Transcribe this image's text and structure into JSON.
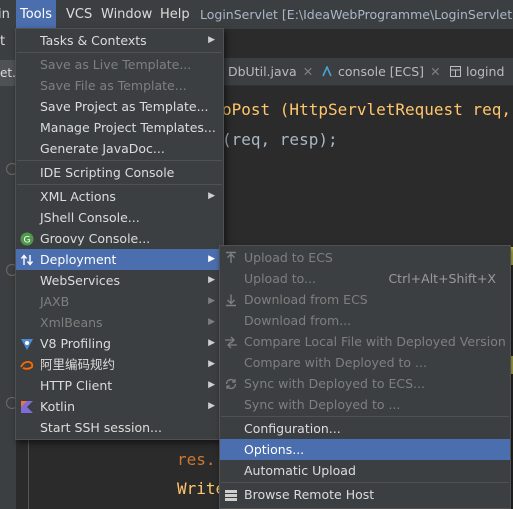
{
  "menubar": {
    "items": [
      "in",
      "Tools",
      "VCS",
      "Window",
      "Help"
    ],
    "title": "LoginServlet [E:\\IdeaWebProgramme\\LoginServlet] - ..."
  },
  "left": {
    "t_label": "t",
    "tab_label": "et.ja"
  },
  "tabs": [
    {
      "label": "DbUtil.java"
    },
    {
      "label": "console [ECS]"
    },
    {
      "label": "logind"
    }
  ],
  "code": {
    "line1": "oPost (HttpServletRequest req,",
    "line2": "(req, resp);",
    "line3": "res.",
    "line4": "Write"
  },
  "tools_menu": {
    "items": [
      {
        "label": "Tasks & Contexts",
        "submenu": true,
        "enabled": true
      },
      {
        "label": "Save as Live Template...",
        "enabled": false
      },
      {
        "label": "Save File as Template...",
        "enabled": false
      },
      {
        "label": "Save Project as Template...",
        "enabled": true
      },
      {
        "label": "Manage Project Templates...",
        "enabled": true
      },
      {
        "label": "Generate JavaDoc...",
        "enabled": true
      },
      {
        "label": "IDE Scripting Console",
        "enabled": true
      },
      {
        "label": "XML Actions",
        "submenu": true,
        "enabled": true
      },
      {
        "label": "JShell Console...",
        "enabled": true
      },
      {
        "label": "Groovy Console...",
        "enabled": true,
        "icon": "groovy-icon"
      },
      {
        "label": "Deployment",
        "submenu": true,
        "enabled": true,
        "selected": true,
        "icon": "deployment-icon"
      },
      {
        "label": "WebServices",
        "submenu": true,
        "enabled": true
      },
      {
        "label": "JAXB",
        "submenu": true,
        "enabled": false
      },
      {
        "label": "XmlBeans",
        "submenu": true,
        "enabled": false
      },
      {
        "label": "V8 Profiling",
        "submenu": true,
        "enabled": true,
        "icon": "v8-icon"
      },
      {
        "label": "阿里编码规约",
        "submenu": true,
        "enabled": true,
        "icon": "alibaba-icon"
      },
      {
        "label": "HTTP Client",
        "submenu": true,
        "enabled": true
      },
      {
        "label": "Kotlin",
        "submenu": true,
        "enabled": true,
        "icon": "kotlin-icon"
      },
      {
        "label": "Start SSH session...",
        "enabled": true
      }
    ]
  },
  "deployment_menu": {
    "items": [
      {
        "label": "Upload to ECS",
        "enabled": false,
        "icon": "upload-icon"
      },
      {
        "label": "Upload to...",
        "enabled": false,
        "shortcut": "Ctrl+Alt+Shift+X"
      },
      {
        "label": "Download from ECS",
        "enabled": false,
        "icon": "download-icon"
      },
      {
        "label": "Download from...",
        "enabled": false
      },
      {
        "label": "Compare Local File with Deployed Version",
        "enabled": false,
        "icon": "compare-icon"
      },
      {
        "label": "Compare with Deployed to ...",
        "enabled": false
      },
      {
        "label": "Sync with Deployed to ECS...",
        "enabled": false,
        "icon": "sync-icon"
      },
      {
        "label": "Sync with Deployed to ...",
        "enabled": false
      },
      {
        "label": "Configuration...",
        "enabled": true
      },
      {
        "label": "Options...",
        "enabled": true,
        "selected": true
      },
      {
        "label": "Automatic Upload",
        "enabled": true
      },
      {
        "label": "Browse Remote Host",
        "enabled": true,
        "icon": "browse-remote-icon"
      }
    ]
  },
  "colors": {
    "menu_bg": "#3c3f41",
    "selection": "#4b6eaf",
    "editor_bg": "#2b2b2b",
    "code_keyword": "#cc7832",
    "code_field": "#9876aa"
  }
}
